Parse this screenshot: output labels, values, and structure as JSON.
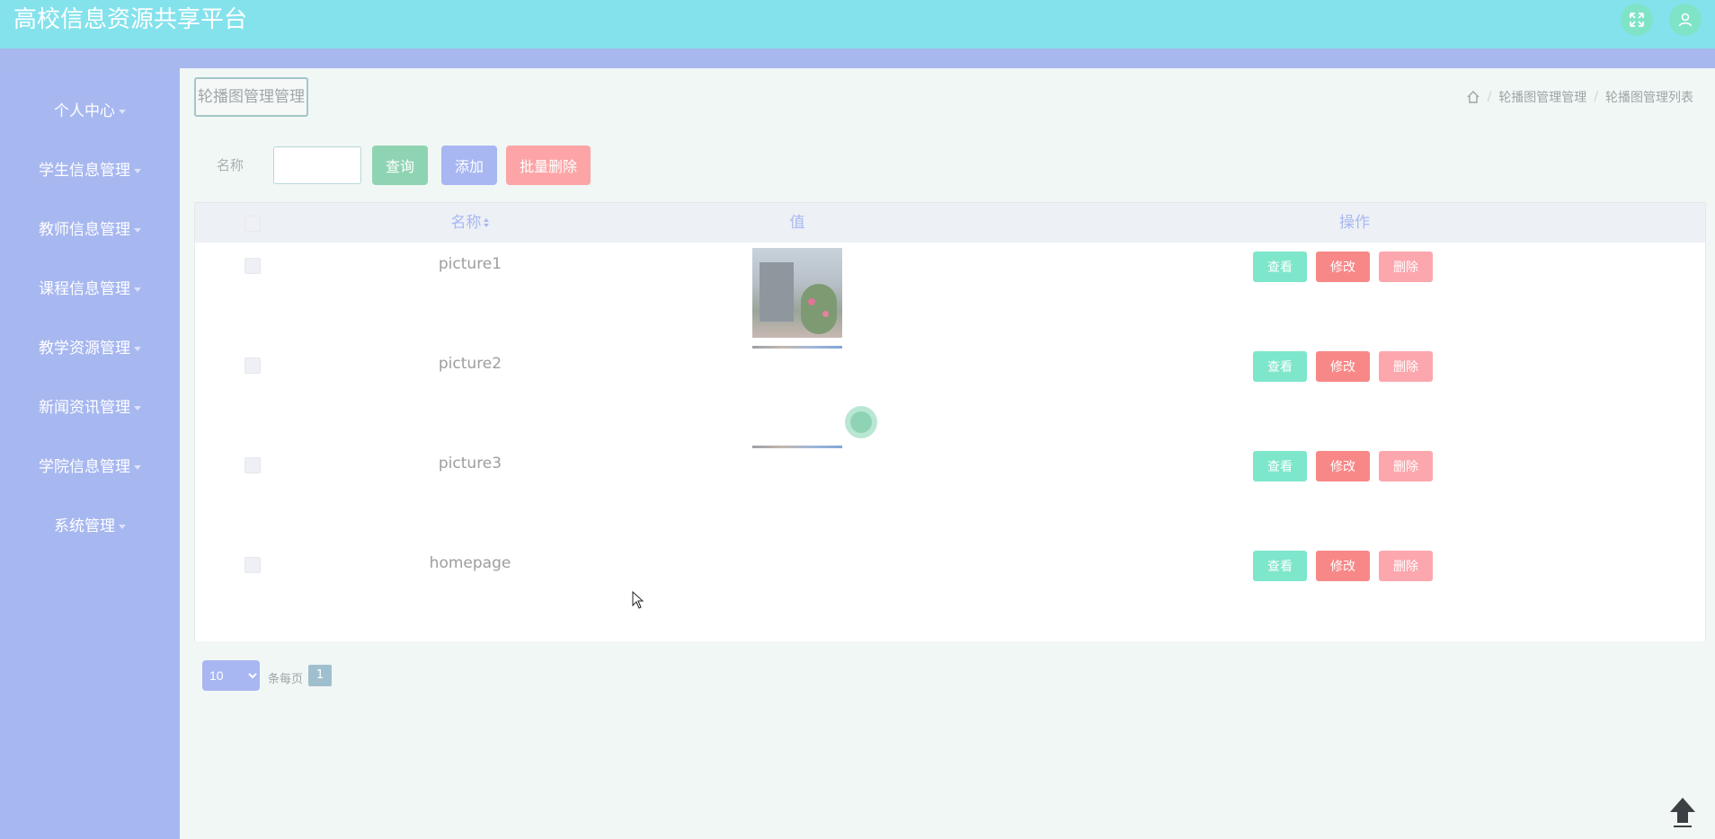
{
  "header": {
    "title": "高校信息资源共享平台",
    "icons": [
      "fullscreen-icon",
      "user-icon"
    ]
  },
  "sidebar": {
    "items": [
      {
        "label": "个人中心"
      },
      {
        "label": "学生信息管理"
      },
      {
        "label": "教师信息管理"
      },
      {
        "label": "课程信息管理"
      },
      {
        "label": "教学资源管理"
      },
      {
        "label": "新闻资讯管理"
      },
      {
        "label": "学院信息管理"
      },
      {
        "label": "系统管理"
      }
    ]
  },
  "page": {
    "tag_title": "轮播图管理管理",
    "breadcrumb": [
      "轮播图管理管理",
      "轮播图管理列表"
    ]
  },
  "filter": {
    "label": "名称",
    "value": "",
    "query_label": "查询",
    "add_label": "添加",
    "batch_delete_label": "批量删除"
  },
  "table": {
    "headers": {
      "name": "名称",
      "value": "值",
      "actions": "操作"
    },
    "sort_icon": "sort-icon",
    "rows": [
      {
        "name": "picture1",
        "thumb": "image"
      },
      {
        "name": "picture2",
        "thumb": "broken"
      },
      {
        "name": "picture3",
        "thumb": "broken"
      },
      {
        "name": "homepage",
        "thumb": "none"
      }
    ],
    "action_labels": {
      "view": "查看",
      "edit": "修改",
      "delete": "删除"
    }
  },
  "pagination": {
    "page_size": "10",
    "page_size_label": "条每页",
    "current_page": "1"
  },
  "colors": {
    "topbar": "#84e2ec",
    "sidebar": "#a7b7f0",
    "query": "#8fd4b2",
    "add": "#a8b7f1",
    "batch_delete": "#fca4a6",
    "view": "#7de6cb",
    "edit": "#f88787",
    "delete": "#fca7ad"
  }
}
